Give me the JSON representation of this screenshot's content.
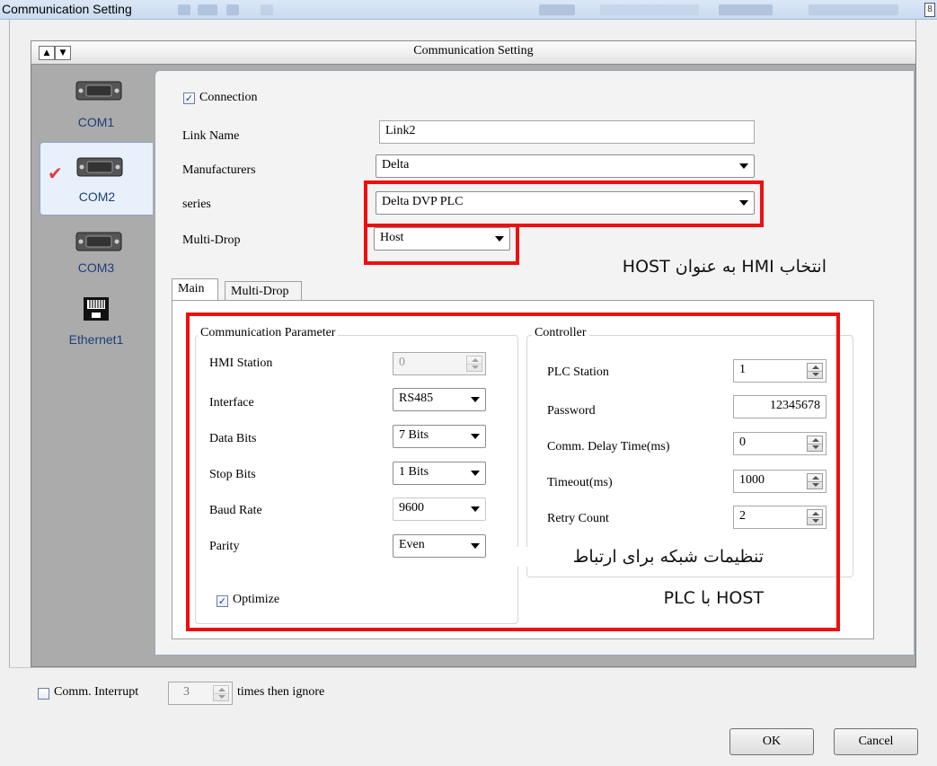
{
  "window": {
    "title": "Communication Setting"
  },
  "header": {
    "title": "Communication Setting",
    "up_arrow": "▲",
    "down_arrow": "▼"
  },
  "sidebar": {
    "items": [
      {
        "label": "COM1",
        "icon": "serial-port-icon",
        "selected": false
      },
      {
        "label": "COM2",
        "icon": "serial-port-icon",
        "selected": true
      },
      {
        "label": "COM3",
        "icon": "serial-port-icon",
        "selected": false
      },
      {
        "label": "Ethernet1",
        "icon": "ethernet-port-icon",
        "selected": false
      }
    ]
  },
  "connection": {
    "checkbox_label": "Connection",
    "checked": true,
    "link_name_label": "Link Name",
    "link_name_value": "Link2",
    "manufacturers_label": "Manufacturers",
    "manufacturers_value": "Delta",
    "series_label": "series",
    "series_value": "Delta DVP PLC",
    "multidrop_label": "Multi-Drop",
    "multidrop_value": "Host"
  },
  "tabs": [
    {
      "label": "Main",
      "active": true
    },
    {
      "label": "Multi-Drop",
      "active": false
    }
  ],
  "comm_params": {
    "title": "Communication Parameter",
    "hmi_station": {
      "label": "HMI Station",
      "value": "0"
    },
    "interface": {
      "label": "Interface",
      "value": "RS485"
    },
    "data_bits": {
      "label": "Data Bits",
      "value": "7 Bits"
    },
    "stop_bits": {
      "label": "Stop Bits",
      "value": "1 Bits"
    },
    "baud_rate": {
      "label": "Baud Rate",
      "value": "9600"
    },
    "parity": {
      "label": "Parity",
      "value": "Even"
    },
    "optimize": {
      "label": "Optimize",
      "checked": true
    }
  },
  "controller": {
    "title": "Controller",
    "plc_station": {
      "label": "PLC Station",
      "value": "1"
    },
    "password": {
      "label": "Password",
      "value": "12345678"
    },
    "comm_delay": {
      "label": "Comm. Delay Time(ms)",
      "value": "0"
    },
    "timeout": {
      "label": "Timeout(ms)",
      "value": "1000"
    },
    "retry_count": {
      "label": "Retry Count",
      "value": "2"
    }
  },
  "annotations": {
    "host_note": "انتخاب HMI به عنوان HOST",
    "network_note_line1": "تنظیمات شبکه برای ارتباط",
    "network_note_line2": "HOST با PLC"
  },
  "footer": {
    "comm_interrupt_label": "Comm. Interrupt",
    "comm_interrupt_checked": false,
    "times_value": "3",
    "times_suffix": "times then ignore",
    "ok_label": "OK",
    "cancel_label": "Cancel"
  },
  "colors": {
    "highlight_red": "#ee0f0f",
    "selection_check": "#e23b3b",
    "com_label_blue": "#1f3d7a"
  }
}
